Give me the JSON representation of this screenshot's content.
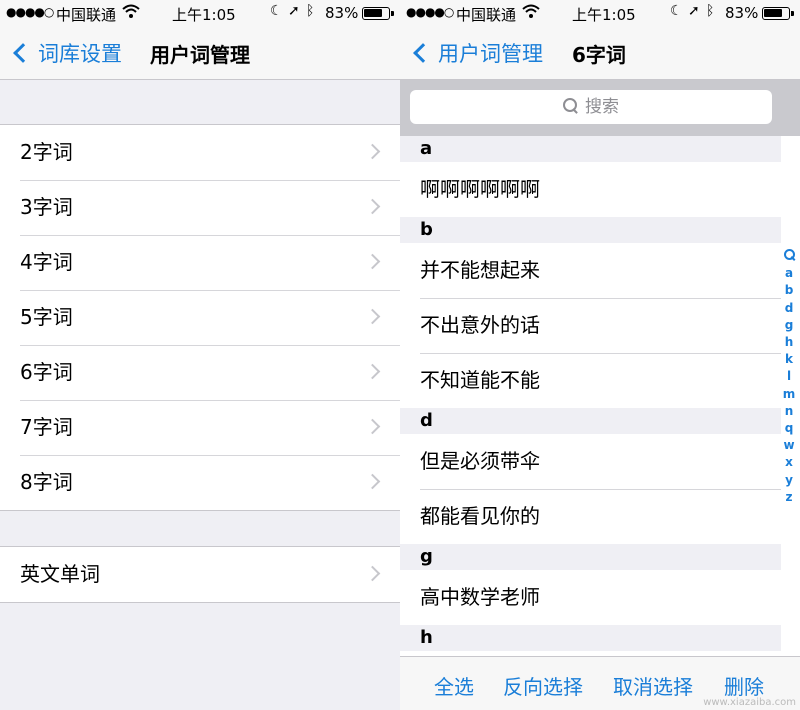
{
  "status": {
    "signal": "●●●●○",
    "carrier": "中国联通",
    "time": "上午1:05",
    "battery_pct": "83%",
    "battery_level": 0.83
  },
  "left": {
    "nav": {
      "back_label": "词库设置",
      "title": "用户词管理"
    },
    "groups": [
      [
        "2字词",
        "3字词",
        "4字词",
        "5字词",
        "6字词",
        "7字词",
        "8字词"
      ],
      [
        "英文单词"
      ]
    ]
  },
  "right": {
    "nav": {
      "back_label": "用户词管理",
      "title": "6字词"
    },
    "search_placeholder": "搜索",
    "sections": [
      {
        "letter": "a",
        "items": [
          "啊啊啊啊啊啊"
        ]
      },
      {
        "letter": "b",
        "items": [
          "并不能想起来",
          "不出意外的话",
          "不知道能不能"
        ]
      },
      {
        "letter": "d",
        "items": [
          "但是必须带伞",
          "都能看见你的"
        ]
      },
      {
        "letter": "g",
        "items": [
          "高中数学老师"
        ]
      },
      {
        "letter": "h",
        "items": []
      }
    ],
    "index": [
      "a",
      "b",
      "d",
      "g",
      "h",
      "k",
      "l",
      "m",
      "n",
      "q",
      "w",
      "x",
      "y",
      "z"
    ],
    "toolbar": {
      "select_all": "全选",
      "invert": "反向选择",
      "deselect": "取消选择",
      "delete": "删除"
    }
  },
  "watermark": "www.xiazaiba.com"
}
